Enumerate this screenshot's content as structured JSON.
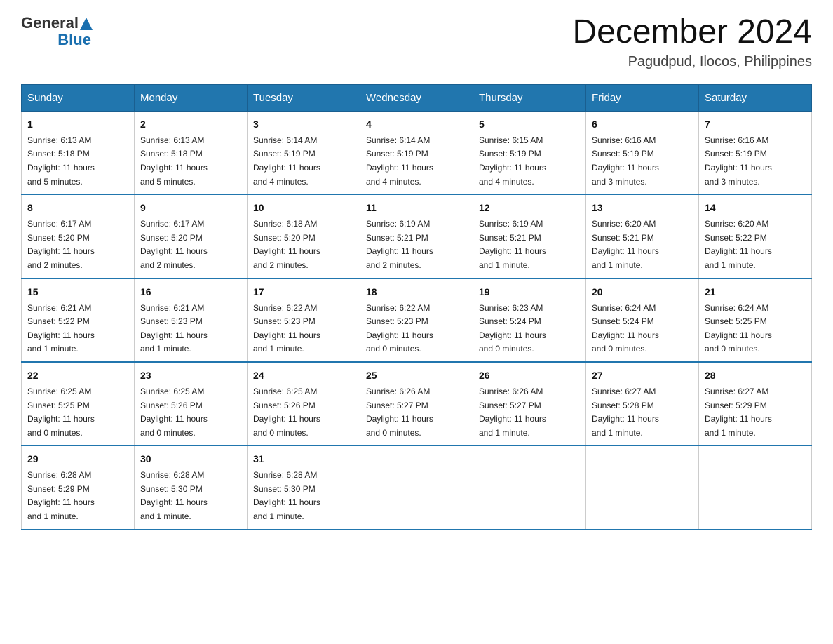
{
  "header": {
    "logo_general": "General",
    "logo_blue": "Blue",
    "month": "December 2024",
    "location": "Pagudpud, Ilocos, Philippines"
  },
  "weekdays": [
    "Sunday",
    "Monday",
    "Tuesday",
    "Wednesday",
    "Thursday",
    "Friday",
    "Saturday"
  ],
  "weeks": [
    [
      {
        "day": "1",
        "sunrise": "6:13 AM",
        "sunset": "5:18 PM",
        "daylight": "11 hours and 5 minutes."
      },
      {
        "day": "2",
        "sunrise": "6:13 AM",
        "sunset": "5:18 PM",
        "daylight": "11 hours and 5 minutes."
      },
      {
        "day": "3",
        "sunrise": "6:14 AM",
        "sunset": "5:19 PM",
        "daylight": "11 hours and 4 minutes."
      },
      {
        "day": "4",
        "sunrise": "6:14 AM",
        "sunset": "5:19 PM",
        "daylight": "11 hours and 4 minutes."
      },
      {
        "day": "5",
        "sunrise": "6:15 AM",
        "sunset": "5:19 PM",
        "daylight": "11 hours and 4 minutes."
      },
      {
        "day": "6",
        "sunrise": "6:16 AM",
        "sunset": "5:19 PM",
        "daylight": "11 hours and 3 minutes."
      },
      {
        "day": "7",
        "sunrise": "6:16 AM",
        "sunset": "5:19 PM",
        "daylight": "11 hours and 3 minutes."
      }
    ],
    [
      {
        "day": "8",
        "sunrise": "6:17 AM",
        "sunset": "5:20 PM",
        "daylight": "11 hours and 2 minutes."
      },
      {
        "day": "9",
        "sunrise": "6:17 AM",
        "sunset": "5:20 PM",
        "daylight": "11 hours and 2 minutes."
      },
      {
        "day": "10",
        "sunrise": "6:18 AM",
        "sunset": "5:20 PM",
        "daylight": "11 hours and 2 minutes."
      },
      {
        "day": "11",
        "sunrise": "6:19 AM",
        "sunset": "5:21 PM",
        "daylight": "11 hours and 2 minutes."
      },
      {
        "day": "12",
        "sunrise": "6:19 AM",
        "sunset": "5:21 PM",
        "daylight": "11 hours and 1 minute."
      },
      {
        "day": "13",
        "sunrise": "6:20 AM",
        "sunset": "5:21 PM",
        "daylight": "11 hours and 1 minute."
      },
      {
        "day": "14",
        "sunrise": "6:20 AM",
        "sunset": "5:22 PM",
        "daylight": "11 hours and 1 minute."
      }
    ],
    [
      {
        "day": "15",
        "sunrise": "6:21 AM",
        "sunset": "5:22 PM",
        "daylight": "11 hours and 1 minute."
      },
      {
        "day": "16",
        "sunrise": "6:21 AM",
        "sunset": "5:23 PM",
        "daylight": "11 hours and 1 minute."
      },
      {
        "day": "17",
        "sunrise": "6:22 AM",
        "sunset": "5:23 PM",
        "daylight": "11 hours and 1 minute."
      },
      {
        "day": "18",
        "sunrise": "6:22 AM",
        "sunset": "5:23 PM",
        "daylight": "11 hours and 0 minutes."
      },
      {
        "day": "19",
        "sunrise": "6:23 AM",
        "sunset": "5:24 PM",
        "daylight": "11 hours and 0 minutes."
      },
      {
        "day": "20",
        "sunrise": "6:24 AM",
        "sunset": "5:24 PM",
        "daylight": "11 hours and 0 minutes."
      },
      {
        "day": "21",
        "sunrise": "6:24 AM",
        "sunset": "5:25 PM",
        "daylight": "11 hours and 0 minutes."
      }
    ],
    [
      {
        "day": "22",
        "sunrise": "6:25 AM",
        "sunset": "5:25 PM",
        "daylight": "11 hours and 0 minutes."
      },
      {
        "day": "23",
        "sunrise": "6:25 AM",
        "sunset": "5:26 PM",
        "daylight": "11 hours and 0 minutes."
      },
      {
        "day": "24",
        "sunrise": "6:25 AM",
        "sunset": "5:26 PM",
        "daylight": "11 hours and 0 minutes."
      },
      {
        "day": "25",
        "sunrise": "6:26 AM",
        "sunset": "5:27 PM",
        "daylight": "11 hours and 0 minutes."
      },
      {
        "day": "26",
        "sunrise": "6:26 AM",
        "sunset": "5:27 PM",
        "daylight": "11 hours and 1 minute."
      },
      {
        "day": "27",
        "sunrise": "6:27 AM",
        "sunset": "5:28 PM",
        "daylight": "11 hours and 1 minute."
      },
      {
        "day": "28",
        "sunrise": "6:27 AM",
        "sunset": "5:29 PM",
        "daylight": "11 hours and 1 minute."
      }
    ],
    [
      {
        "day": "29",
        "sunrise": "6:28 AM",
        "sunset": "5:29 PM",
        "daylight": "11 hours and 1 minute."
      },
      {
        "day": "30",
        "sunrise": "6:28 AM",
        "sunset": "5:30 PM",
        "daylight": "11 hours and 1 minute."
      },
      {
        "day": "31",
        "sunrise": "6:28 AM",
        "sunset": "5:30 PM",
        "daylight": "11 hours and 1 minute."
      },
      null,
      null,
      null,
      null
    ]
  ],
  "labels": {
    "sunrise": "Sunrise:",
    "sunset": "Sunset:",
    "daylight": "Daylight:"
  }
}
